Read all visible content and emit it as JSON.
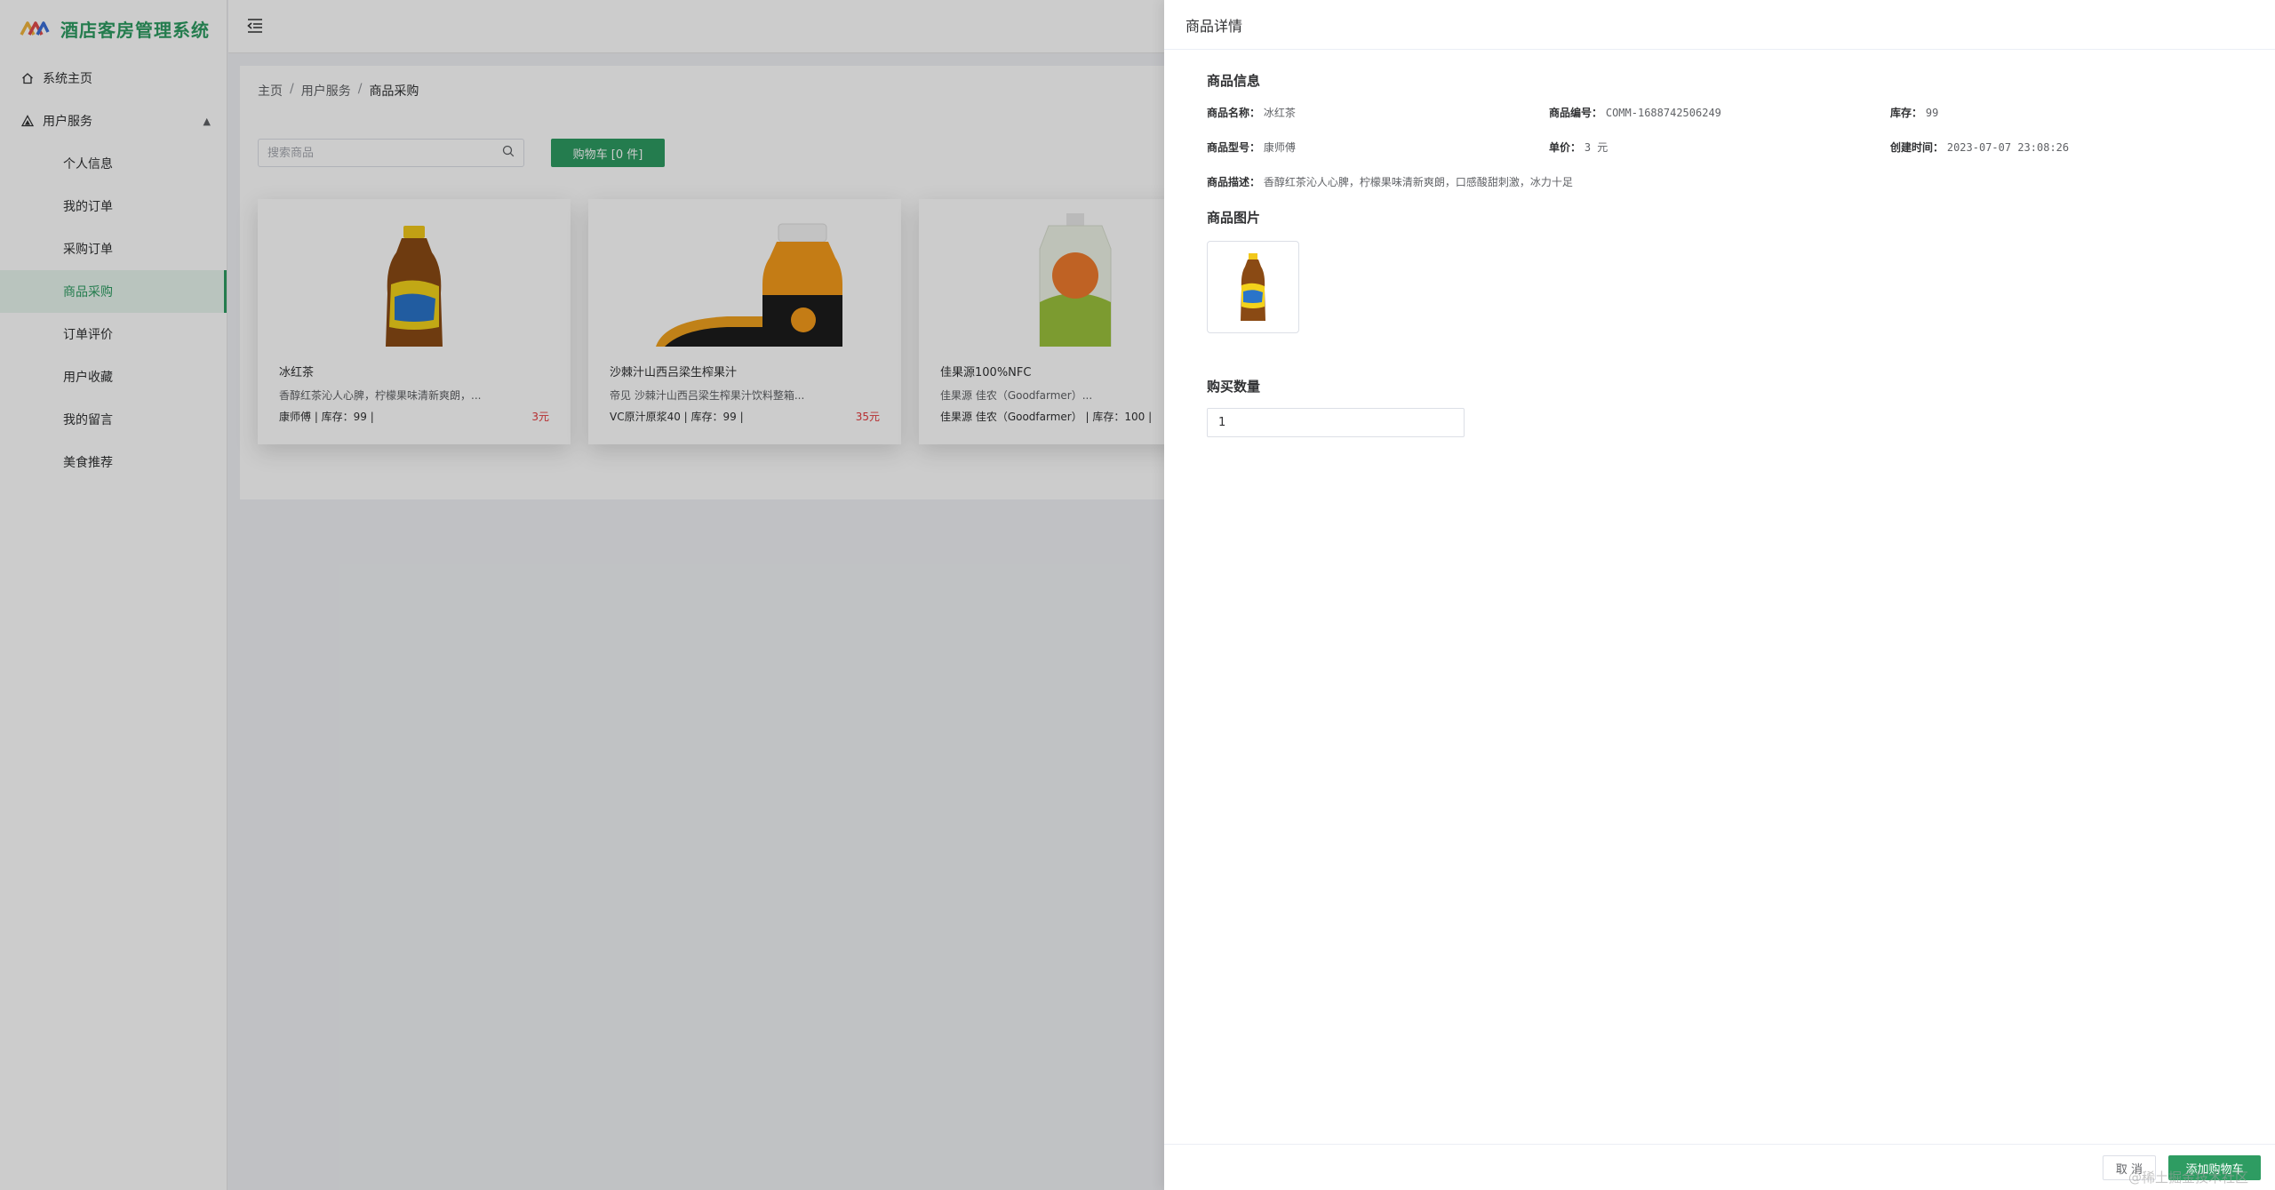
{
  "app": {
    "title": "酒店客房管理系统",
    "brand_color": "#2e9c62"
  },
  "sidebar": {
    "home": {
      "label": "系统主页",
      "icon": "home-icon"
    },
    "group": {
      "label": "用户服务",
      "icon": "user-service-icon",
      "expanded": true
    },
    "items": [
      {
        "label": "个人信息"
      },
      {
        "label": "我的订单"
      },
      {
        "label": "采购订单"
      },
      {
        "label": "商品采购",
        "active": true
      },
      {
        "label": "订单评价"
      },
      {
        "label": "用户收藏"
      },
      {
        "label": "我的留言"
      },
      {
        "label": "美食推荐"
      }
    ]
  },
  "breadcrumb": [
    "主页",
    "用户服务",
    "商品采购"
  ],
  "search": {
    "placeholder": "搜索商品",
    "value": ""
  },
  "cart_button": {
    "label": "购物车 [0 件]"
  },
  "products": [
    {
      "title": "冰红茶",
      "desc": "香醇红茶沁人心脾，柠檬果味清新爽朗，...",
      "meta": "康师傅 | 库存：99 |",
      "price": "3元"
    },
    {
      "title": "沙棘汁山西吕梁生榨果汁",
      "desc": "帝见 沙棘汁山西吕梁生榨果汁饮料整箱...",
      "meta": "VC原汁原浆40 | 库存：99 |",
      "price": "35元"
    },
    {
      "title": "佳果源100%NFC",
      "desc": "佳果源 佳农（Goodfarmer）...",
      "meta": "佳果源 佳农（Goodfarmer） | 库存：100 |",
      "price": ""
    }
  ],
  "drawer": {
    "title": "商品详情",
    "info_title": "商品信息",
    "fields": {
      "name": {
        "label": "商品名称：",
        "value": "冰红茶"
      },
      "code": {
        "label": "商品编号：",
        "value": "COMM-1688742506249"
      },
      "stock": {
        "label": "库存：",
        "value": "99"
      },
      "model": {
        "label": "商品型号：",
        "value": "康师傅"
      },
      "price": {
        "label": "单价：",
        "value": "3 元"
      },
      "created": {
        "label": "创建时间：",
        "value": "2023-07-07 23:08:26"
      },
      "desc": {
        "label": "商品描述：",
        "value": "香醇红茶沁人心脾，柠檬果味清新爽朗，口感酸甜刺激，冰力十足"
      }
    },
    "image_title": "商品图片",
    "qty_title": "购买数量",
    "qty_value": "1",
    "cancel_label": "取 消",
    "add_label": "添加购物车"
  },
  "watermark": "@稀土掘金技术社区"
}
